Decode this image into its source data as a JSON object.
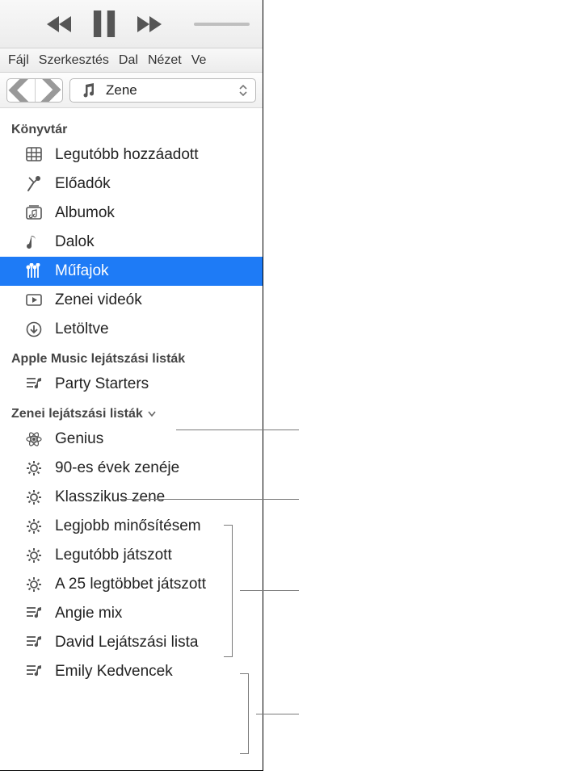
{
  "menubar": [
    "Fájl",
    "Szerkesztés",
    "Dal",
    "Nézet",
    "Ve"
  ],
  "section_selector": {
    "label": "Zene"
  },
  "groups": [
    {
      "header": "Könyvtár",
      "collapsible": false,
      "items": [
        {
          "icon": "grid-icon",
          "label": "Legutóbb hozzáadott",
          "selected": false
        },
        {
          "icon": "mic-icon",
          "label": "Előadók",
          "selected": false
        },
        {
          "icon": "album-icon",
          "label": "Albumok",
          "selected": false
        },
        {
          "icon": "note-icon",
          "label": "Dalok",
          "selected": false
        },
        {
          "icon": "genres-icon",
          "label": "Műfajok",
          "selected": true
        },
        {
          "icon": "video-icon",
          "label": "Zenei videók",
          "selected": false
        },
        {
          "icon": "download-icon",
          "label": "Letöltve",
          "selected": false
        }
      ]
    },
    {
      "header": "Apple Music lejátszási listák",
      "collapsible": false,
      "items": [
        {
          "icon": "playlist-icon",
          "label": "Party Starters",
          "selected": false
        }
      ]
    },
    {
      "header": "Zenei lejátszási listák",
      "collapsible": true,
      "items": [
        {
          "icon": "atom-icon",
          "label": "Genius",
          "selected": false
        },
        {
          "icon": "gear-icon",
          "label": "90-es évek zenéje",
          "selected": false
        },
        {
          "icon": "gear-icon",
          "label": "Klasszikus zene",
          "selected": false
        },
        {
          "icon": "gear-icon",
          "label": "Legjobb minősítésem",
          "selected": false
        },
        {
          "icon": "gear-icon",
          "label": "Legutóbb játszott",
          "selected": false
        },
        {
          "icon": "gear-icon",
          "label": "A 25 legtöbbet játszott",
          "selected": false
        },
        {
          "icon": "playlist-icon",
          "label": "Angie mix",
          "selected": false
        },
        {
          "icon": "playlist-icon",
          "label": "David Lejátszási lista",
          "selected": false
        },
        {
          "icon": "playlist-icon",
          "label": "Emily Kedvencek",
          "selected": false
        }
      ]
    }
  ]
}
